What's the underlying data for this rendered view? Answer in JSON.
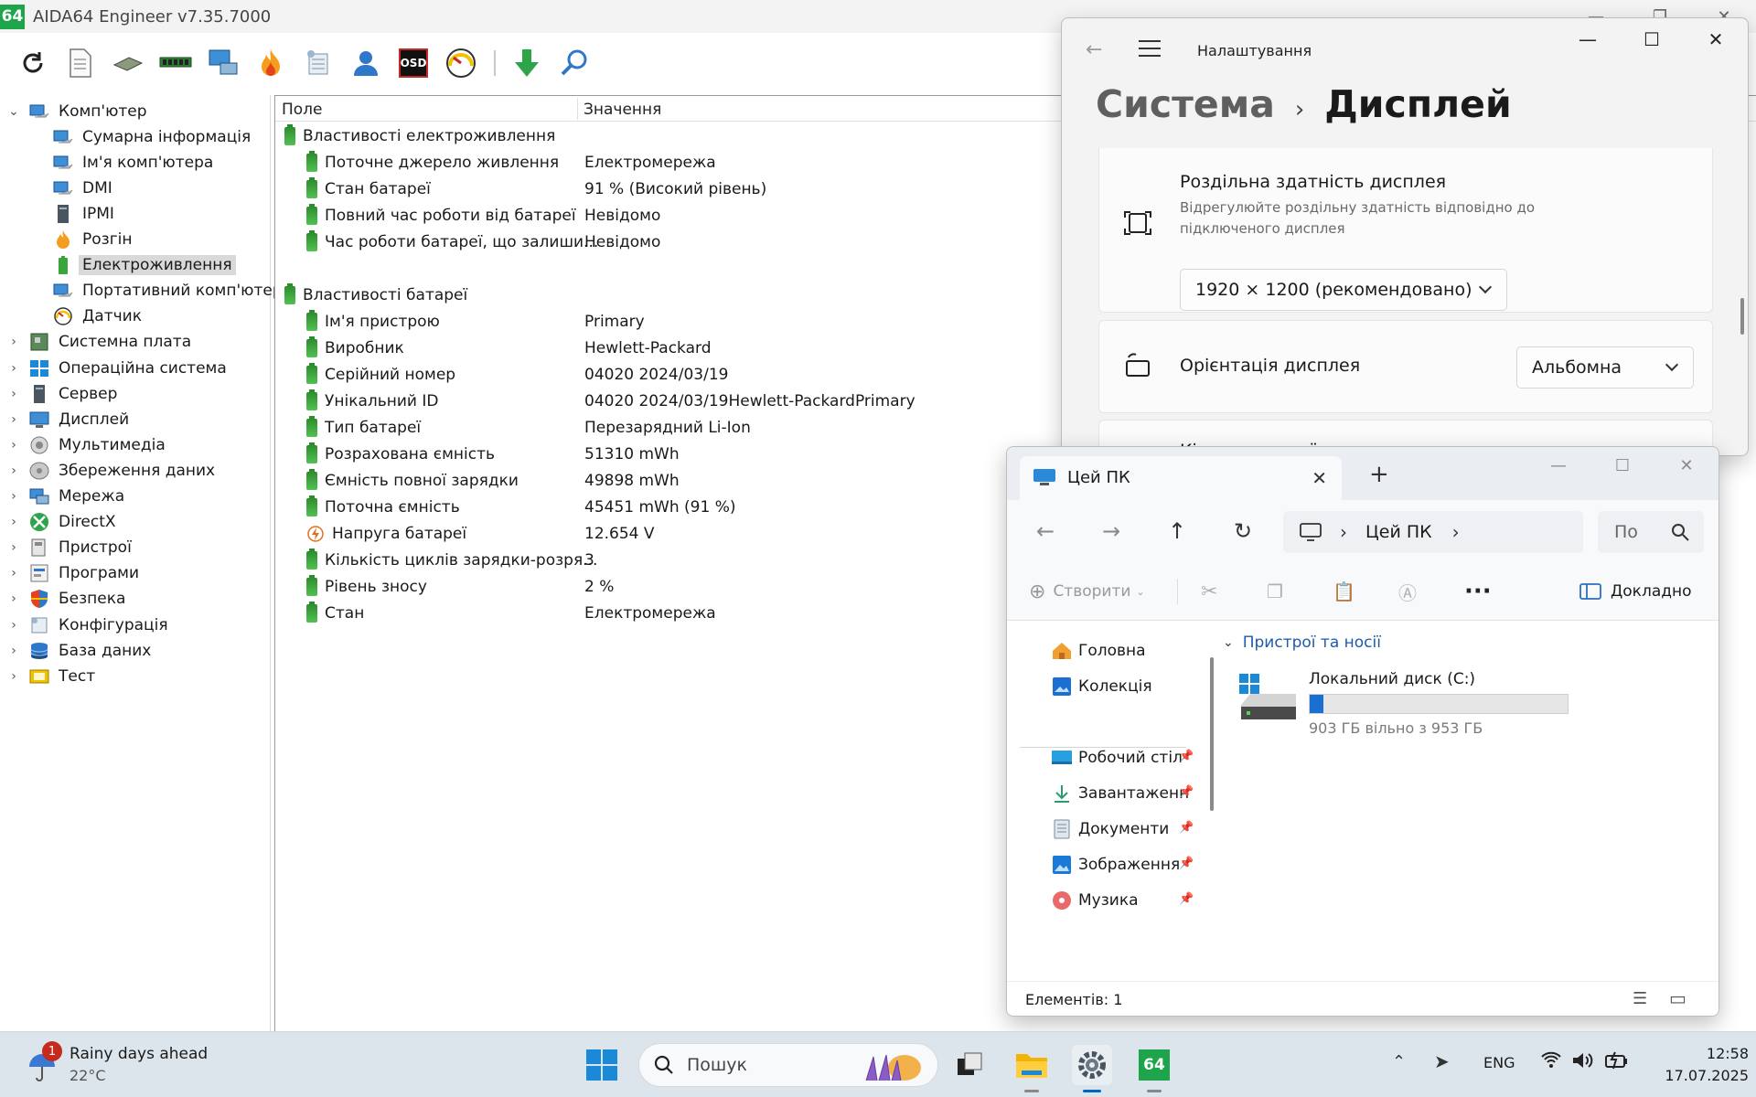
{
  "aida": {
    "title": "AIDA64 Engineer v7.35.7000",
    "logo": "64",
    "toolbar": [
      "refresh-icon",
      "report-icon",
      "motherboard-icon",
      "memory-icon",
      "network-icon",
      "flame-icon",
      "tools-icon",
      "user-icon",
      "osd-icon",
      "gauge-icon",
      "download-icon",
      "search-icon"
    ],
    "osd_label": "OSD",
    "tree": [
      {
        "label": "Комп'ютер",
        "level": 0,
        "expanded": true,
        "icon": "computer-icon"
      },
      {
        "label": "Сумарна інформація",
        "level": 1,
        "icon": "computer-icon"
      },
      {
        "label": "Ім'я комп'ютера",
        "level": 1,
        "icon": "computer-icon"
      },
      {
        "label": "DMI",
        "level": 1,
        "icon": "computer-icon"
      },
      {
        "label": "IPMI",
        "level": 1,
        "icon": "server-icon"
      },
      {
        "label": "Розгін",
        "level": 1,
        "icon": "flame-icon"
      },
      {
        "label": "Електроживлення",
        "level": 1,
        "icon": "battery-icon",
        "selected": true
      },
      {
        "label": "Портативний комп'ютер",
        "level": 1,
        "icon": "computer-icon"
      },
      {
        "label": "Датчик",
        "level": 1,
        "icon": "gauge-icon"
      },
      {
        "label": "Системна плата",
        "level": 0,
        "icon": "motherboard-icon"
      },
      {
        "label": "Операційна система",
        "level": 0,
        "icon": "windows-icon"
      },
      {
        "label": "Сервер",
        "level": 0,
        "icon": "server-icon"
      },
      {
        "label": "Дисплей",
        "level": 0,
        "icon": "monitor-icon"
      },
      {
        "label": "Мультимедіа",
        "level": 0,
        "icon": "speaker-icon"
      },
      {
        "label": "Збереження даних",
        "level": 0,
        "icon": "disk-icon"
      },
      {
        "label": "Мережа",
        "level": 0,
        "icon": "network-icon"
      },
      {
        "label": "DirectX",
        "level": 0,
        "icon": "xbox-icon"
      },
      {
        "label": "Пристрої",
        "level": 0,
        "icon": "devices-icon"
      },
      {
        "label": "Програми",
        "level": 0,
        "icon": "programs-icon"
      },
      {
        "label": "Безпека",
        "level": 0,
        "icon": "shield-icon"
      },
      {
        "label": "Конфігурація",
        "level": 0,
        "icon": "config-icon"
      },
      {
        "label": "База даних",
        "level": 0,
        "icon": "database-icon"
      },
      {
        "label": "Тест",
        "level": 0,
        "icon": "benchmark-icon"
      }
    ],
    "list_headers": {
      "field": "Поле",
      "value": "Значення"
    },
    "rows": [
      {
        "type": "group",
        "label": "Властивості електроживлення"
      },
      {
        "type": "item",
        "field": "Поточне джерело живлення",
        "value": "Електромережа"
      },
      {
        "type": "item",
        "field": "Стан батареї",
        "value": "91 % (Високий рівень)"
      },
      {
        "type": "item",
        "field": "Повний час роботи від батареї",
        "value": "Невідомо"
      },
      {
        "type": "item",
        "field": "Час роботи батареї, що залиши...",
        "value": "Невідомо"
      },
      {
        "type": "blank"
      },
      {
        "type": "group",
        "label": "Властивості батареї"
      },
      {
        "type": "item",
        "field": "Ім'я пристрою",
        "value": "Primary"
      },
      {
        "type": "item",
        "field": "Виробник",
        "value": "Hewlett-Packard"
      },
      {
        "type": "item",
        "field": "Серійний номер",
        "value": "04020 2024/03/19"
      },
      {
        "type": "item",
        "field": "Унікальний ID",
        "value": "04020 2024/03/19Hewlett-PackardPrimary"
      },
      {
        "type": "item",
        "field": "Тип батареї",
        "value": "Перезарядний Li-Ion"
      },
      {
        "type": "item",
        "field": "Розрахована ємність",
        "value": "51310 mWh"
      },
      {
        "type": "item",
        "field": "Ємність повної зарядки",
        "value": "49898 mWh"
      },
      {
        "type": "item",
        "field": "Поточна ємність",
        "value": "45451 mWh  (91 %)"
      },
      {
        "type": "item",
        "field": "Напруга батареї",
        "value": "12.654 V",
        "icon": "voltage-icon"
      },
      {
        "type": "item",
        "field": "Кількість циклів зарядки-розря...",
        "value": "3"
      },
      {
        "type": "item",
        "field": "Рівень зносу",
        "value": "2 %"
      },
      {
        "type": "item",
        "field": "Стан",
        "value": "Електромережа"
      }
    ]
  },
  "settings": {
    "app_title": "Налаштування",
    "breadcrumb_parent": "Система",
    "breadcrumb_current": "Дисплей",
    "resolution": {
      "title": "Роздільна здатність дисплея",
      "desc": "Відрегулюйте роздільну здатність відповідно до підключеного дисплея",
      "value": "1920 × 1200 (рекомендовано)"
    },
    "orientation": {
      "title": "Орієнтація дисплея",
      "value": "Альбомна"
    },
    "multi": {
      "title": "Кілька дисплеїв"
    }
  },
  "explorer": {
    "tab_title": "Цей ПК",
    "address": "Цей ПК",
    "search_placeholder": "По",
    "cmd_new": "Створити",
    "cmd_details": "Докладно",
    "nav": [
      {
        "label": "Головна",
        "icon": "home-icon",
        "pinned": false
      },
      {
        "label": "Колекція",
        "icon": "gallery-icon",
        "pinned": false
      },
      {
        "label": "Робочий стіл",
        "icon": "desktop-icon",
        "pinned": true
      },
      {
        "label": "Завантаженн",
        "icon": "download-icon",
        "pinned": true
      },
      {
        "label": "Документи",
        "icon": "documents-icon",
        "pinned": true
      },
      {
        "label": "Зображення",
        "icon": "pictures-icon",
        "pinned": true
      },
      {
        "label": "Музика",
        "icon": "music-icon",
        "pinned": true
      }
    ],
    "section_title": "Пристрої та носії",
    "drive": {
      "name": "Локальний диск (C:)",
      "free_text": "903 ГБ вільно з 953 ГБ",
      "used_fraction": 0.0525
    },
    "status": "Елементів: 1"
  },
  "taskbar": {
    "weather_title": "Rainy days ahead",
    "weather_temp": "22°C",
    "weather_badge": "1",
    "search_placeholder": "Пошук",
    "lang": "ENG",
    "time": "12:58",
    "date": "17.07.2025"
  },
  "colors": {
    "accent": "#0067c0",
    "battery_green": "#3aa53a",
    "aida_logo": "#1ea44a"
  }
}
